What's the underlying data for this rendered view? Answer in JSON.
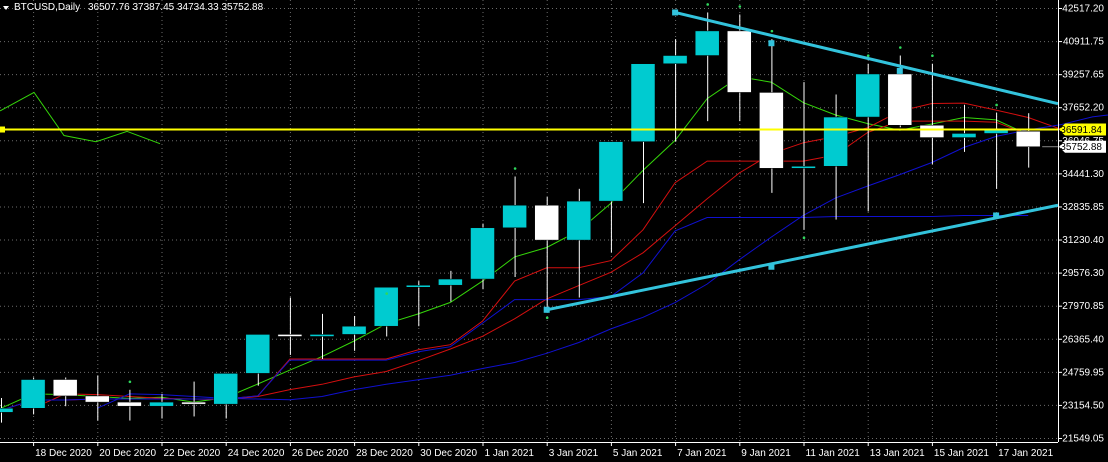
{
  "header": {
    "symbol": "BTCUSD,Daily",
    "ohlc": "36507.76 37387.45 34734.33 35752.88"
  },
  "price_labels": {
    "line": "36591.84",
    "bid": "35752.88"
  },
  "colors": {
    "background": "#000000",
    "grid": "#6b6b6b",
    "axis": "#ffffff",
    "bull": "#00cbd0",
    "bear": "#ffffff",
    "trendline": "#33c3dc",
    "hline": "#ffff00",
    "line_price_label_bg": "#ffff00",
    "bid_label_bg": "#ffffff",
    "ma_green": "#35d60a",
    "ma_red": "#d40f0f",
    "ma_blue": "#1010d0",
    "fractal": "#2fd85c"
  },
  "chart_data": {
    "type": "candlestick",
    "title": "BTCUSD,Daily",
    "x_tick_labels": [
      "18 Dec 2020",
      "20 Dec 2020",
      "22 Dec 2020",
      "24 Dec 2020",
      "26 Dec 2020",
      "28 Dec 2020",
      "30 Dec 2020",
      "1 Jan 2021",
      "3 Jan 2021",
      "5 Jan 2021",
      "7 Jan 2021",
      "9 Jan 2021",
      "11 Jan 2021",
      "13 Jan 2021",
      "15 Jan 2021",
      "17 Jan 2021"
    ],
    "y_tick_labels": [
      "42517.20",
      "40911.75",
      "39257.65",
      "37652.20",
      "36046.75",
      "34441.30",
      "32835.85",
      "31230.40",
      "29576.30",
      "27970.85",
      "26365.40",
      "24759.95",
      "23154.50",
      "21549.05"
    ],
    "ylim": [
      21549.05,
      42517.2
    ],
    "series": [
      {
        "name": "BTCUSD",
        "dates": [
          "17 Dec 2020",
          "18 Dec 2020",
          "19 Dec 2020",
          "20 Dec 2020",
          "21 Dec 2020",
          "22 Dec 2020",
          "23 Dec 2020",
          "24 Dec 2020",
          "25 Dec 2020",
          "26 Dec 2020",
          "27 Dec 2020",
          "28 Dec 2020",
          "29 Dec 2020",
          "30 Dec 2020",
          "31 Dec 2020",
          "1 Jan 2021",
          "2 Jan 2021",
          "3 Jan 2021",
          "4 Jan 2021",
          "5 Jan 2021",
          "6 Jan 2021",
          "7 Jan 2021",
          "8 Jan 2021",
          "9 Jan 2021",
          "10 Jan 2021",
          "11 Jan 2021",
          "12 Jan 2021",
          "13 Jan 2021",
          "14 Jan 2021",
          "15 Jan 2021",
          "16 Jan 2021",
          "17 Jan 2021",
          "18 Jan 2021"
        ],
        "open": [
          22800,
          23000,
          24400,
          23600,
          23300,
          23100,
          23300,
          23200,
          24700,
          26600,
          26500,
          26600,
          27000,
          28900,
          29000,
          29300,
          31800,
          32900,
          31200,
          33100,
          36000,
          39800,
          40200,
          41400,
          38400,
          34700,
          34800,
          37200,
          39300,
          36800,
          36200,
          36400,
          36507.76
        ],
        "high": [
          23500,
          24500,
          24500,
          24600,
          23900,
          23700,
          24300,
          23900,
          24900,
          28400,
          27600,
          27500,
          28200,
          29200,
          29700,
          32000,
          34300,
          33300,
          33700,
          34600,
          36900,
          41000,
          42300,
          42200,
          41000,
          38900,
          38300,
          39800,
          40200,
          39800,
          37800,
          37400,
          37387.45
        ],
        "low": [
          22300,
          22700,
          23100,
          22400,
          22400,
          22500,
          22600,
          22500,
          24100,
          25600,
          25400,
          25800,
          26500,
          27000,
          28200,
          28800,
          29400,
          27800,
          28400,
          30600,
          33000,
          36000,
          37000,
          37000,
          33500,
          31700,
          32200,
          32600,
          36700,
          34900,
          35500,
          33700,
          34734.33
        ],
        "close": [
          23000,
          24400,
          23600,
          23300,
          23100,
          23300,
          23200,
          24700,
          26600,
          26500,
          26600,
          27000,
          28900,
          29000,
          29300,
          31800,
          32900,
          31200,
          33100,
          36000,
          39800,
          40200,
          41400,
          38400,
          34700,
          34800,
          37200,
          39300,
          36800,
          36200,
          36400,
          36600,
          35752.88
        ]
      },
      {
        "name": "",
        "values": [
          37500,
          38400,
          36300,
          36000,
          36500,
          35900
        ]
      }
    ]
  }
}
